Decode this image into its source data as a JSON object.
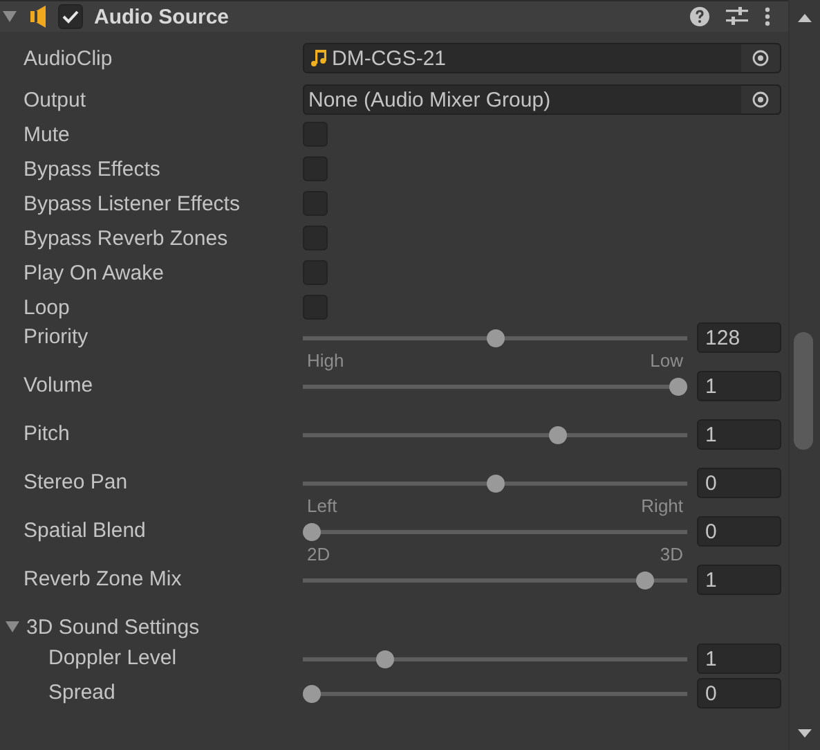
{
  "component": {
    "title": "Audio Source",
    "expanded": true,
    "enabled": true
  },
  "properties": [
    {
      "kind": "asset",
      "label": "AudioClip",
      "value": "DM-CGS-21"
    },
    {
      "kind": "object",
      "label": "Output",
      "value": "None (Audio Mixer Group)"
    },
    {
      "kind": "checkbox",
      "label": "Mute",
      "checked": false
    },
    {
      "kind": "checkbox",
      "label": "Bypass Effects",
      "checked": false
    },
    {
      "kind": "checkbox",
      "label": "Bypass Listener Effects",
      "checked": false
    },
    {
      "kind": "checkbox",
      "label": "Bypass Reverb Zones",
      "checked": false
    },
    {
      "kind": "checkbox",
      "label": "Play On Awake",
      "checked": false
    },
    {
      "kind": "checkbox",
      "label": "Loop",
      "checked": false
    },
    {
      "kind": "slider",
      "label": "Priority",
      "level": 0.5,
      "value": "128",
      "min_label": "High",
      "max_label": "Low"
    },
    {
      "kind": "slider",
      "label": "Volume",
      "level": 1,
      "value": "1"
    },
    {
      "kind": "slider",
      "label": "Pitch",
      "level": 0.67,
      "value": "1"
    },
    {
      "kind": "slider",
      "label": "Stereo Pan",
      "level": 0.5,
      "value": "0",
      "min_label": "Left",
      "max_label": "Right"
    },
    {
      "kind": "slider",
      "label": "Spatial Blend",
      "level": 0,
      "value": "0",
      "min_label": "2D",
      "max_label": "3D"
    },
    {
      "kind": "slider",
      "label": "Reverb Zone Mix",
      "level": 0.91,
      "value": "1"
    }
  ],
  "section": {
    "label": "3D Sound Settings",
    "expanded": true,
    "properties": [
      {
        "kind": "slider",
        "label": "Doppler Level",
        "level": 0.2,
        "value": "1"
      },
      {
        "kind": "slider",
        "label": "Spread",
        "level": 0,
        "value": "0"
      }
    ]
  }
}
